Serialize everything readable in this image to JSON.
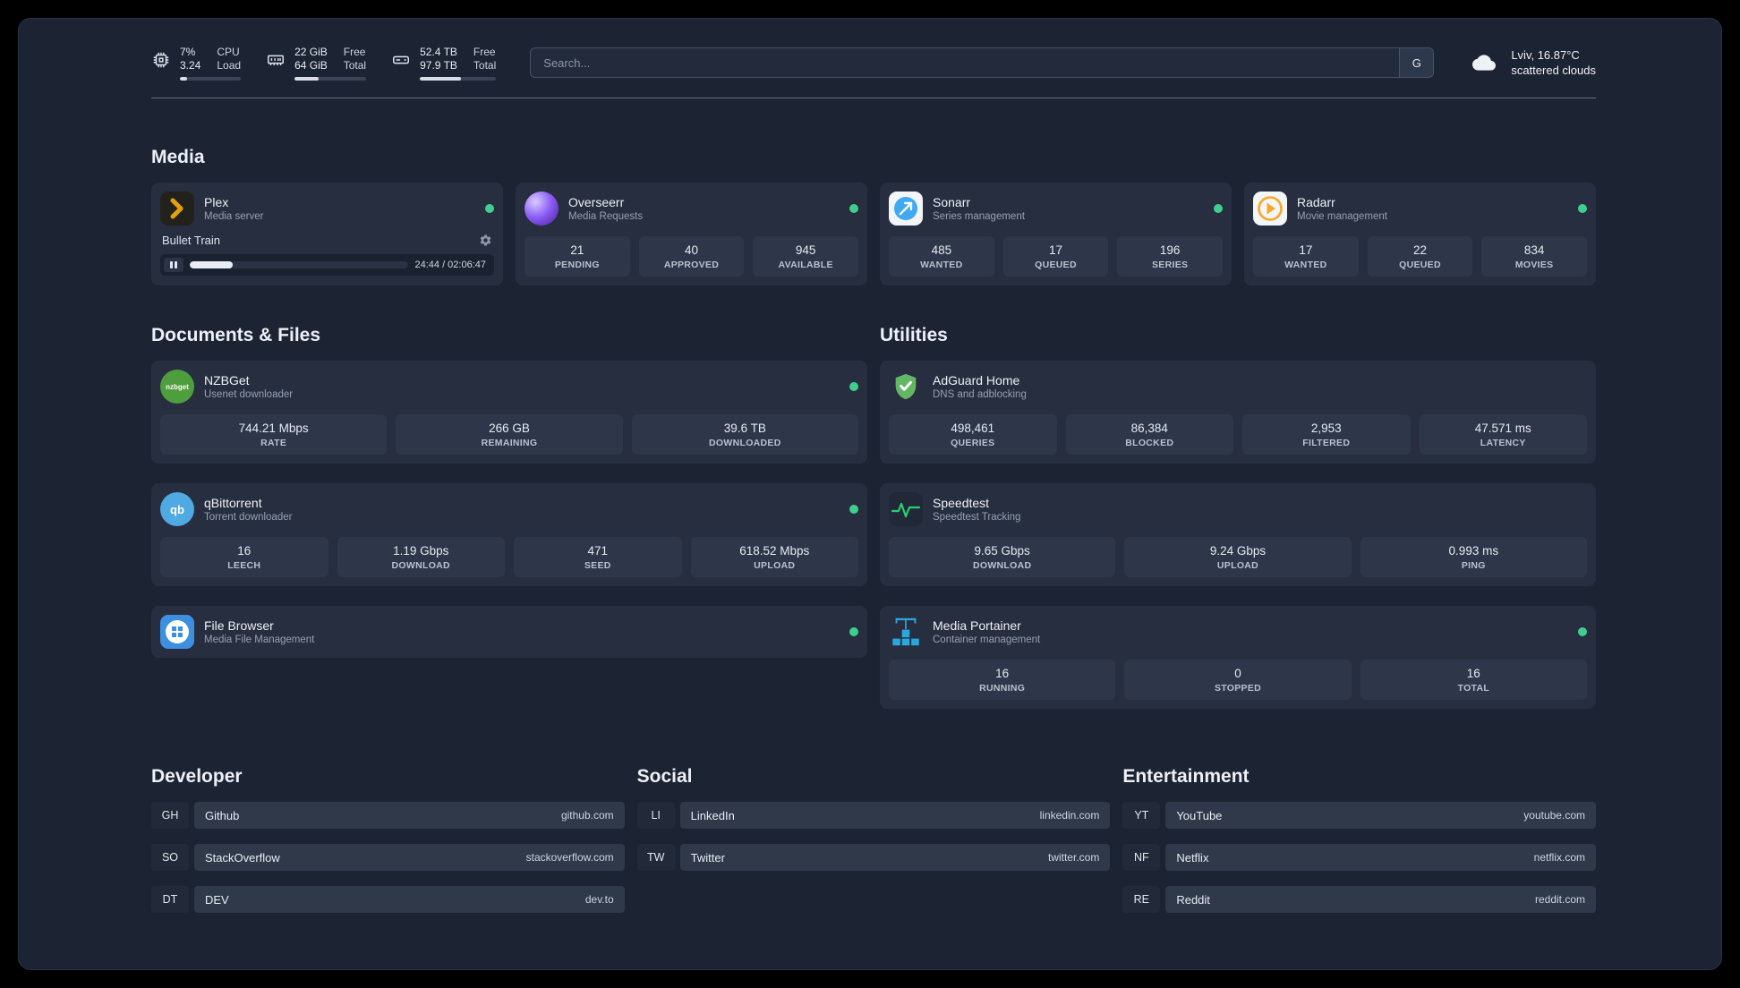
{
  "topbar": {
    "cpu": {
      "value_top": "7%",
      "value_bottom": "3.24",
      "label_top": "CPU",
      "label_bottom": "Load",
      "bar_percent": 12
    },
    "ram": {
      "value_top": "22 GiB",
      "value_bottom": "64 GiB",
      "label_top": "Free",
      "label_bottom": "Total",
      "bar_percent": 34
    },
    "disk": {
      "value_top": "52.4 TB",
      "value_bottom": "97.9 TB",
      "label_top": "Free",
      "label_bottom": "Total",
      "bar_percent": 54
    },
    "search": {
      "placeholder": "Search...",
      "engine_label": "G"
    },
    "weather": {
      "line1": "Lviv, 16.87°C",
      "line2": "scattered clouds"
    }
  },
  "colors": {
    "accent_green": "#3ecf8e",
    "panel_bg": "#1c2332",
    "card_bg": "#272e3f"
  },
  "sections": {
    "media": {
      "title": "Media",
      "cards": [
        {
          "name": "Plex",
          "subtitle": "Media server",
          "player": {
            "title": "Bullet Train",
            "time": "24:44 / 02:06:47",
            "progress_percent": 19.5
          }
        },
        {
          "name": "Overseerr",
          "subtitle": "Media Requests",
          "stats": [
            {
              "value": "21",
              "label": "PENDING"
            },
            {
              "value": "40",
              "label": "APPROVED"
            },
            {
              "value": "945",
              "label": "AVAILABLE"
            }
          ]
        },
        {
          "name": "Sonarr",
          "subtitle": "Series management",
          "stats": [
            {
              "value": "485",
              "label": "WANTED"
            },
            {
              "value": "17",
              "label": "QUEUED"
            },
            {
              "value": "196",
              "label": "SERIES"
            }
          ]
        },
        {
          "name": "Radarr",
          "subtitle": "Movie management",
          "stats": [
            {
              "value": "17",
              "label": "WANTED"
            },
            {
              "value": "22",
              "label": "QUEUED"
            },
            {
              "value": "834",
              "label": "MOVIES"
            }
          ]
        }
      ]
    },
    "documents": {
      "title": "Documents & Files",
      "cards": [
        {
          "name": "NZBGet",
          "subtitle": "Usenet downloader",
          "stats": [
            {
              "value": "744.21 Mbps",
              "label": "RATE"
            },
            {
              "value": "266 GB",
              "label": "REMAINING"
            },
            {
              "value": "39.6 TB",
              "label": "DOWNLOADED"
            }
          ]
        },
        {
          "name": "qBittorrent",
          "subtitle": "Torrent downloader",
          "stats": [
            {
              "value": "16",
              "label": "LEECH"
            },
            {
              "value": "1.19 Gbps",
              "label": "DOWNLOAD"
            },
            {
              "value": "471",
              "label": "SEED"
            },
            {
              "value": "618.52 Mbps",
              "label": "UPLOAD"
            }
          ]
        },
        {
          "name": "File Browser",
          "subtitle": "Media File Management"
        }
      ]
    },
    "utilities": {
      "title": "Utilities",
      "cards": [
        {
          "name": "AdGuard Home",
          "subtitle": "DNS and adblocking",
          "stats": [
            {
              "value": "498,461",
              "label": "QUERIES"
            },
            {
              "value": "86,384",
              "label": "BLOCKED"
            },
            {
              "value": "2,953",
              "label": "FILTERED"
            },
            {
              "value": "47.571 ms",
              "label": "LATENCY"
            }
          ]
        },
        {
          "name": "Speedtest",
          "subtitle": "Speedtest Tracking",
          "stats": [
            {
              "value": "9.65 Gbps",
              "label": "DOWNLOAD"
            },
            {
              "value": "9.24 Gbps",
              "label": "UPLOAD"
            },
            {
              "value": "0.993 ms",
              "label": "PING"
            }
          ]
        },
        {
          "name": "Media Portainer",
          "subtitle": "Container management",
          "stats": [
            {
              "value": "16",
              "label": "RUNNING"
            },
            {
              "value": "0",
              "label": "STOPPED"
            },
            {
              "value": "16",
              "label": "TOTAL"
            }
          ]
        }
      ]
    },
    "developer": {
      "title": "Developer",
      "links": [
        {
          "abbr": "GH",
          "name": "Github",
          "url": "github.com"
        },
        {
          "abbr": "SO",
          "name": "StackOverflow",
          "url": "stackoverflow.com"
        },
        {
          "abbr": "DT",
          "name": "DEV",
          "url": "dev.to"
        }
      ]
    },
    "social": {
      "title": "Social",
      "links": [
        {
          "abbr": "LI",
          "name": "LinkedIn",
          "url": "linkedin.com"
        },
        {
          "abbr": "TW",
          "name": "Twitter",
          "url": "twitter.com"
        }
      ]
    },
    "entertainment": {
      "title": "Entertainment",
      "links": [
        {
          "abbr": "YT",
          "name": "YouTube",
          "url": "youtube.com"
        },
        {
          "abbr": "NF",
          "name": "Netflix",
          "url": "netflix.com"
        },
        {
          "abbr": "RE",
          "name": "Reddit",
          "url": "reddit.com"
        }
      ]
    }
  }
}
